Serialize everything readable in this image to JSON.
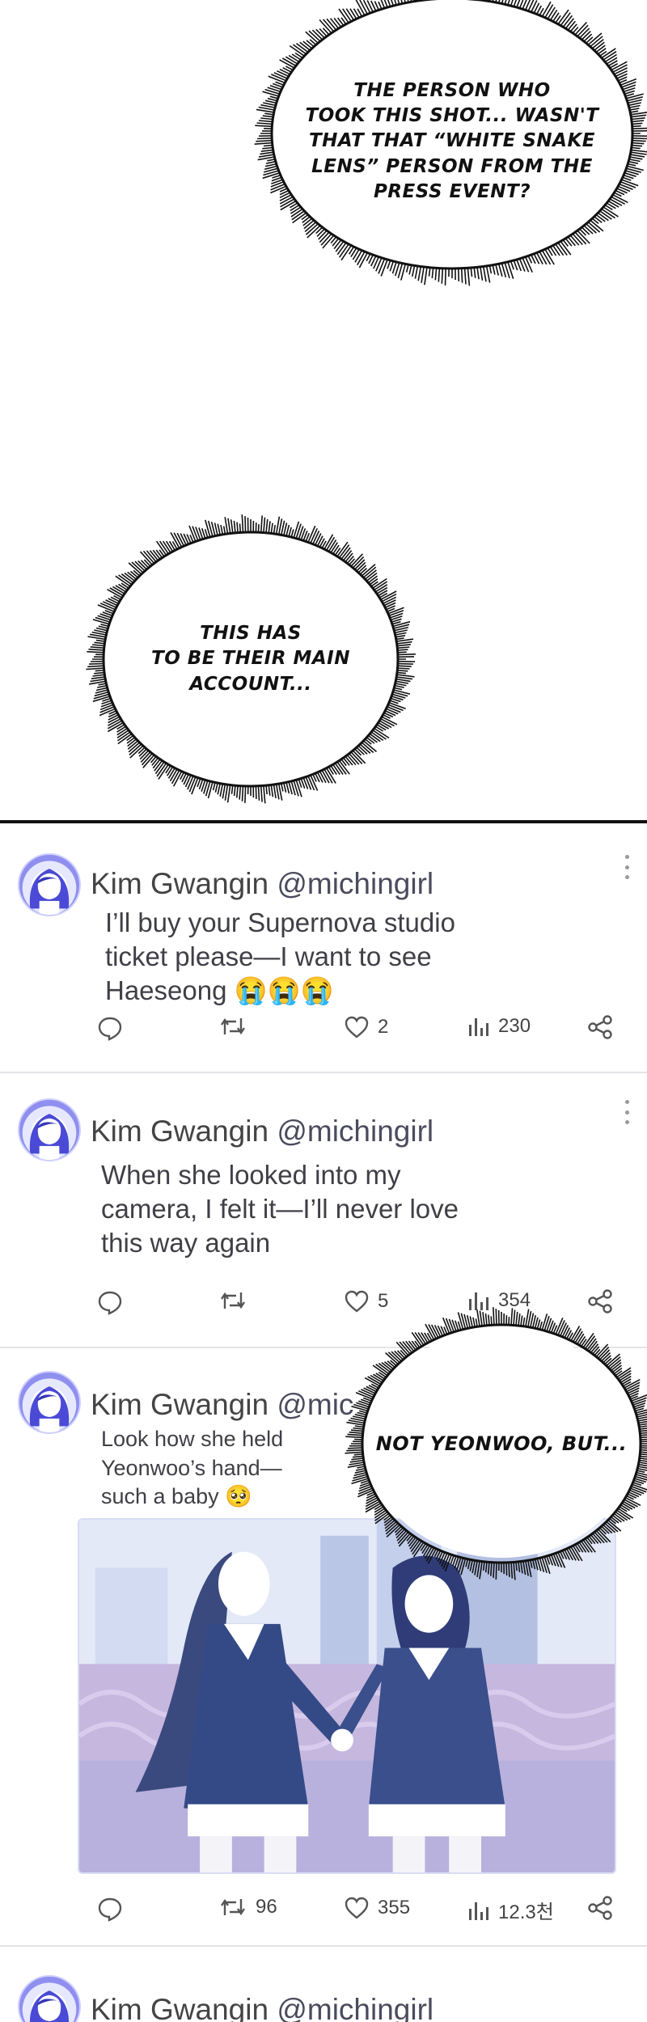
{
  "panel": {
    "bubbles": [
      {
        "text_lines": [
          "THE PERSON WHO",
          "TOOK THIS SHOT... WASN'T",
          "THAT THAT “WHITE SNAKE",
          "LENS” PERSON FROM THE",
          "PRESS EVENT?"
        ]
      },
      {
        "text_lines": [
          "THIS HAS",
          "TO BE THEIR MAIN",
          "ACCOUNT..."
        ]
      },
      {
        "text_lines": [
          "NOT YEONWOO, BUT..."
        ]
      }
    ]
  },
  "posts": [
    {
      "user": {
        "name": "Kim Gwangin",
        "handle": "@michingirl",
        "avatar_icon": "avatar-icon"
      },
      "text": "I’ll buy your Supernova studio ticket please—I want to see Haeseong 😭😭😭",
      "text_lines": [
        "I’ll buy your Supernova studio",
        "ticket please—I want to see",
        "Haeseong 😭😭😭"
      ],
      "actions": {
        "reply": "",
        "repost": "",
        "like": "2",
        "views": "230"
      }
    },
    {
      "user": {
        "name": "Kim Gwangin",
        "handle": "@michingirl",
        "avatar_icon": "avatar-icon"
      },
      "text_lines": [
        "When she looked into my",
        "camera, I felt it—I’ll never love",
        "this way again"
      ],
      "actions": {
        "reply": "",
        "repost": "",
        "like": "5",
        "views": "354"
      }
    },
    {
      "user": {
        "name": "Kim Gwangin",
        "handle": "@mic",
        "avatar_icon": "avatar-icon"
      },
      "text_lines": [
        "Look how she held",
        "Yeonwoo’s hand—",
        "such a baby 🥺"
      ],
      "has_image": true,
      "actions": {
        "reply": "",
        "repost": "96",
        "like": "355",
        "views": "12.3천"
      }
    },
    {
      "user": {
        "name": "Kim Gwangin",
        "handle": "@michingirl",
        "avatar_icon": "avatar-icon"
      }
    }
  ],
  "icons": {
    "reply": "speech-bubble-icon",
    "repost": "repost-arrows-icon",
    "like": "heart-icon",
    "views": "bar-chart-icon",
    "share": "share-icon",
    "more": "more-dots-icon"
  },
  "colors": {
    "text": "#3f3f46",
    "handle": "#4b4b5e",
    "divider": "#e3e3e8",
    "avatar_ring": "#8f8ff0"
  }
}
